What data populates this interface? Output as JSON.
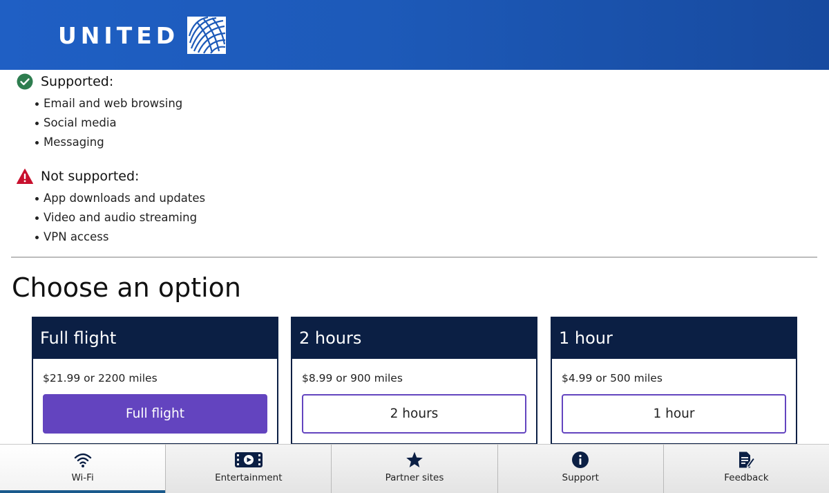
{
  "header": {
    "brand": "UNITED",
    "color": "#1d5ab9"
  },
  "support": {
    "supported": {
      "title": "Supported:",
      "icon": "check-circle-icon",
      "icon_color": "#2e7d4f",
      "items": [
        "Email and web browsing",
        "Social media",
        "Messaging"
      ]
    },
    "not_supported": {
      "title": "Not supported:",
      "icon": "warning-triangle-icon",
      "icon_color": "#c8102e",
      "items": [
        "App downloads and updates",
        "Video and audio streaming",
        "VPN access"
      ]
    }
  },
  "options": {
    "title": "Choose an option",
    "plans": [
      {
        "name": "Full flight",
        "price": "$21.99 or 2200 miles",
        "button": "Full flight",
        "primary": true
      },
      {
        "name": "2 hours",
        "price": "$8.99 or 900 miles",
        "button": "2 hours",
        "primary": false
      },
      {
        "name": "1 hour",
        "price": "$4.99 or 500 miles",
        "button": "1 hour",
        "primary": false
      }
    ],
    "header_color": "#0b1f44",
    "accent_color": "#6344bf"
  },
  "tabbar": {
    "tabs": [
      {
        "label": "Wi-Fi",
        "icon": "wifi-icon",
        "active": true
      },
      {
        "label": "Entertainment",
        "icon": "film-icon",
        "active": false
      },
      {
        "label": "Partner sites",
        "icon": "star-icon",
        "active": false
      },
      {
        "label": "Support",
        "icon": "info-icon",
        "active": false
      },
      {
        "label": "Feedback",
        "icon": "edit-document-icon",
        "active": false
      }
    ],
    "active_color": "#1a5a8c"
  }
}
